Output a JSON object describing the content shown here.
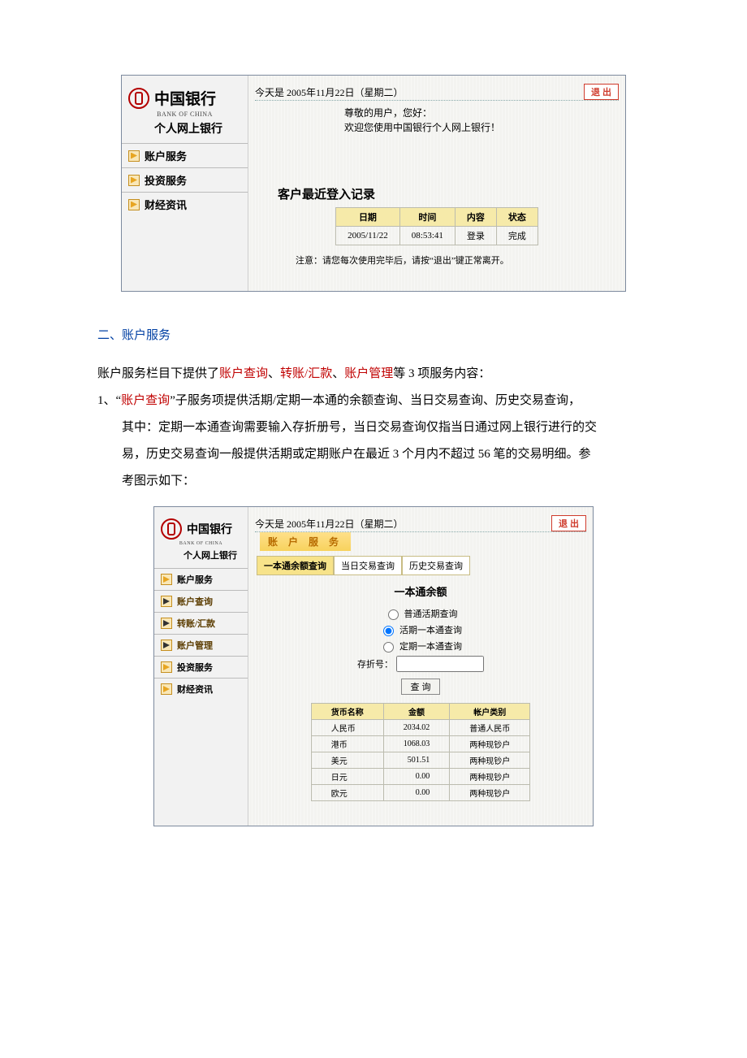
{
  "shot1": {
    "brand": "中国银行",
    "brand_en": "BANK OF CHINA",
    "brand_sub": "个人网上银行",
    "menu": [
      "账户服务",
      "投资服务",
      "财经资讯"
    ],
    "date": "今天是 2005年11月22日（星期二）",
    "exit": "退 出",
    "greet1": "尊敬的用户，您好：",
    "greet2": "欢迎您使用中国银行个人网上银行！",
    "hist_title": "客户最近登入记录",
    "hist_head": [
      "日期",
      "时间",
      "内容",
      "状态"
    ],
    "hist_row": [
      "2005/11/22",
      "08:53:41",
      "登录",
      "完成"
    ],
    "note": "注意：请您每次使用完毕后，请按“退出”键正常离开。"
  },
  "article": {
    "h2": "二、账户服务",
    "p1a": "账户服务栏目下提供了",
    "p1b": "账户查询",
    "p1c": "、",
    "p1d": "转账/汇款",
    "p1e": "、",
    "p1f": "账户管理",
    "p1g": "等 3 项服务内容：",
    "p2a": "1、“",
    "p2b": "账户查询",
    "p2c": "”子服务项提供活期/定期一本通的余额查询、当日交易查询、历史交易查询，",
    "p3": "其中：定期一本通查询需要输入存折册号，当日交易查询仅指当日通过网上银行进行的交",
    "p4": "易，历史交易查询一般提供活期或定期账户在最近 3 个月内不超过 56 笔的交易明细。参",
    "p5": "考图示如下："
  },
  "shot2": {
    "brand": "中国银行",
    "brand_en": "BANK OF CHINA",
    "brand_sub": "个人网上银行",
    "menu": [
      {
        "t": "账户服务",
        "c": "black"
      },
      {
        "t": "账户查询",
        "c": ""
      },
      {
        "t": "转账/汇款",
        "c": ""
      },
      {
        "t": "账户管理",
        "c": ""
      },
      {
        "t": "投资服务",
        "c": "black"
      },
      {
        "t": "财经资讯",
        "c": "black"
      }
    ],
    "date": "今天是 2005年11月22日（星期二）",
    "exit": "退 出",
    "section": "账 户 服 务",
    "tabs": [
      "一本通余额查询",
      "当日交易查询",
      "历史交易查询"
    ],
    "title": "一本通余额",
    "opts": [
      "普通活期查询",
      "活期一本通查询",
      "定期一本通查询"
    ],
    "book_label": "存折号：",
    "query": "查 询",
    "bal_head": [
      "货币名称",
      "金额",
      "帐户类别"
    ],
    "bal_rows": [
      [
        "人民币",
        "2034.02",
        "普通人民币"
      ],
      [
        "港币",
        "1068.03",
        "两种现钞户"
      ],
      [
        "美元",
        "501.51",
        "两种现钞户"
      ],
      [
        "日元",
        "0.00",
        "两种现钞户"
      ],
      [
        "欧元",
        "0.00",
        "两种现钞户"
      ]
    ]
  }
}
